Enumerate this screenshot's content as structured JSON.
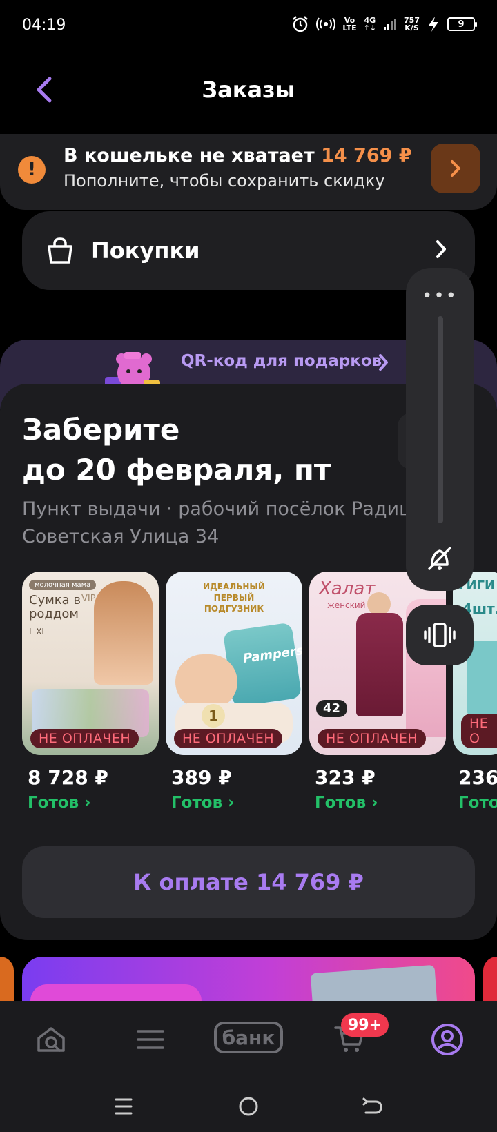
{
  "status_bar": {
    "time": "04:19",
    "network_top": "Vo",
    "network_bottom": "LTE",
    "gen_top": "4G",
    "gen_bottom": "↑↓",
    "speed_top": "757",
    "speed_bottom": "K/S",
    "battery": "9"
  },
  "header": {
    "title": "Заказы",
    "back_icon": "chevron-left-icon"
  },
  "wallet_alert": {
    "prefix": "В кошельке не хватает",
    "amount": "14 769 ₽",
    "subtitle": "Пополните, чтобы сохранить скидку",
    "icon": "exclamation-icon",
    "accent": "#f5904a"
  },
  "purchases": {
    "label": "Покупки",
    "icon": "shopping-bag-icon"
  },
  "qr_promo": {
    "label": "QR-код для подарков"
  },
  "pickup": {
    "title_line1": "Заберите",
    "title_line2": "до 20 февраля, пт",
    "address_line1": "Пункт выдачи · рабочий посёлок Радищ",
    "address_line2": "Советская Улица 34",
    "products": [
      {
        "badge": "НЕ ОПЛАЧЕН",
        "price": "8 728 ₽",
        "status": "Готов",
        "img_title": "Сумка в роддом",
        "img_tag": "молочная мама",
        "img_sub": "L-XL",
        "img_vip": "VIP"
      },
      {
        "badge": "НЕ ОПЛАЧЕН",
        "price": "389 ₽",
        "status": "Готов",
        "img_title": "ИДЕАЛЬНЫЙ ПЕРВЫЙ ПОДГУЗНИК",
        "img_brand": "Pampers",
        "img_size": "1"
      },
      {
        "badge": "НЕ ОПЛАЧЕН",
        "price": "323 ₽",
        "status": "Готов",
        "img_title": "Халат",
        "img_sub": "женский",
        "img_count": "42"
      },
      {
        "badge": "НЕ О",
        "price": "236",
        "status": "Гото",
        "img_title": "ГИГИ Т",
        "img_sub": "4шт."
      }
    ],
    "pay_button": "К оплате 14 769 ₽"
  },
  "tabbar": {
    "items": [
      {
        "name": "home",
        "icon": "search-home-icon"
      },
      {
        "name": "catalog",
        "icon": "menu-lines-icon"
      },
      {
        "name": "bank",
        "label": "банк"
      },
      {
        "name": "cart",
        "icon": "cart-icon",
        "badge": "99+"
      },
      {
        "name": "profile",
        "icon": "profile-icon"
      }
    ]
  },
  "volume_panel": {
    "more": "•••",
    "mute_icon": "mute-icon",
    "vibrate_icon": "vibrate-icon"
  },
  "colors": {
    "accent_purple": "#a87bf0",
    "ready_green": "#23c068",
    "unpaid_red": "#ff6b7a",
    "badge_red": "#f0384e"
  }
}
